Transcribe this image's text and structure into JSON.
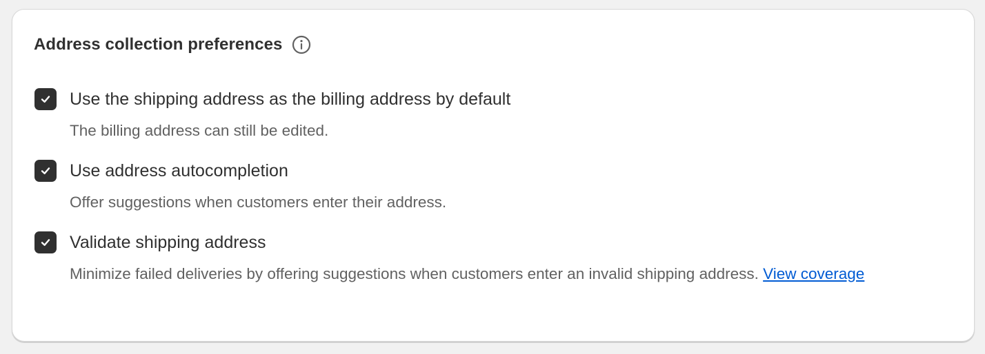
{
  "card": {
    "title": "Address collection preferences",
    "info_icon": "info-circle-icon"
  },
  "options": [
    {
      "label": "Use the shipping address as the billing address by default",
      "checked": true,
      "help": "The billing address can still be edited."
    },
    {
      "label": "Use address autocompletion",
      "checked": true,
      "help": "Offer suggestions when customers enter their address."
    },
    {
      "label": "Validate shipping address",
      "checked": true,
      "help": "Minimize failed deliveries by offering suggestions when customers enter an invalid shipping address.",
      "link": "View coverage"
    }
  ],
  "colors": {
    "checkbox_fill": "#303030",
    "link": "#005bd3",
    "help_text": "#616161"
  }
}
